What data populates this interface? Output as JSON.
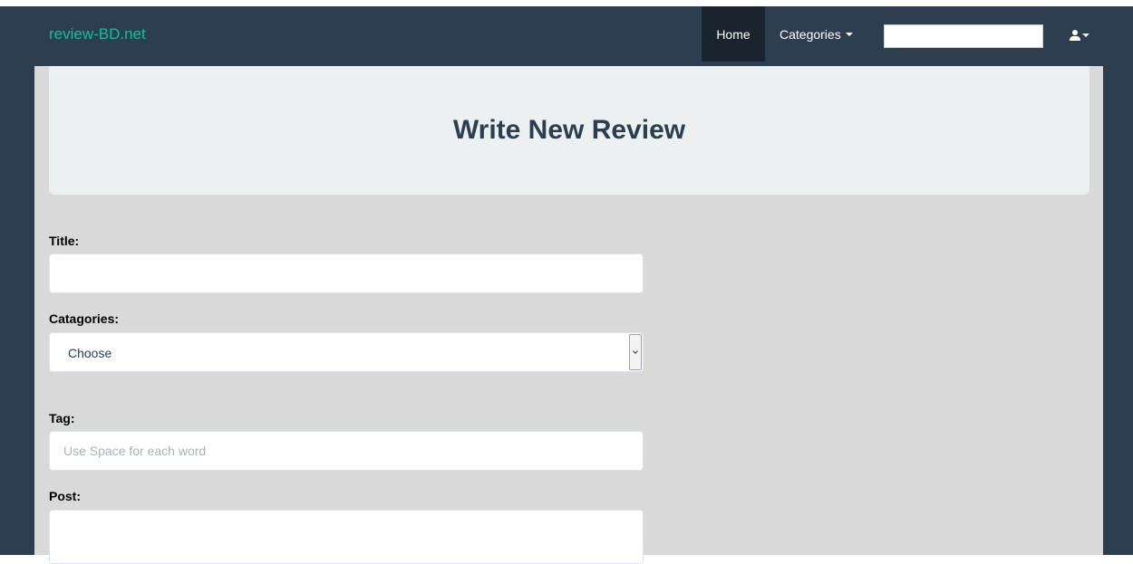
{
  "navbar": {
    "brand": "review-BD.net",
    "home_label": "Home",
    "categories_label": "Categories",
    "search_value": "",
    "user_icon": "user-icon"
  },
  "page": {
    "title": "Write New Review"
  },
  "form": {
    "title_label": "Title:",
    "title_value": "",
    "categories_label": "Catagories:",
    "categories_selected": "Choose",
    "tag_label": "Tag:",
    "tag_placeholder": "Use Space for each word",
    "post_label": "Post:",
    "post_value": ""
  },
  "colors": {
    "navbar_bg": "#2c3e50",
    "brand": "#18bc9c",
    "active_nav_bg": "#1a242f",
    "content_bg": "#d9d9d9",
    "header_panel_bg": "#ecf0f1"
  }
}
